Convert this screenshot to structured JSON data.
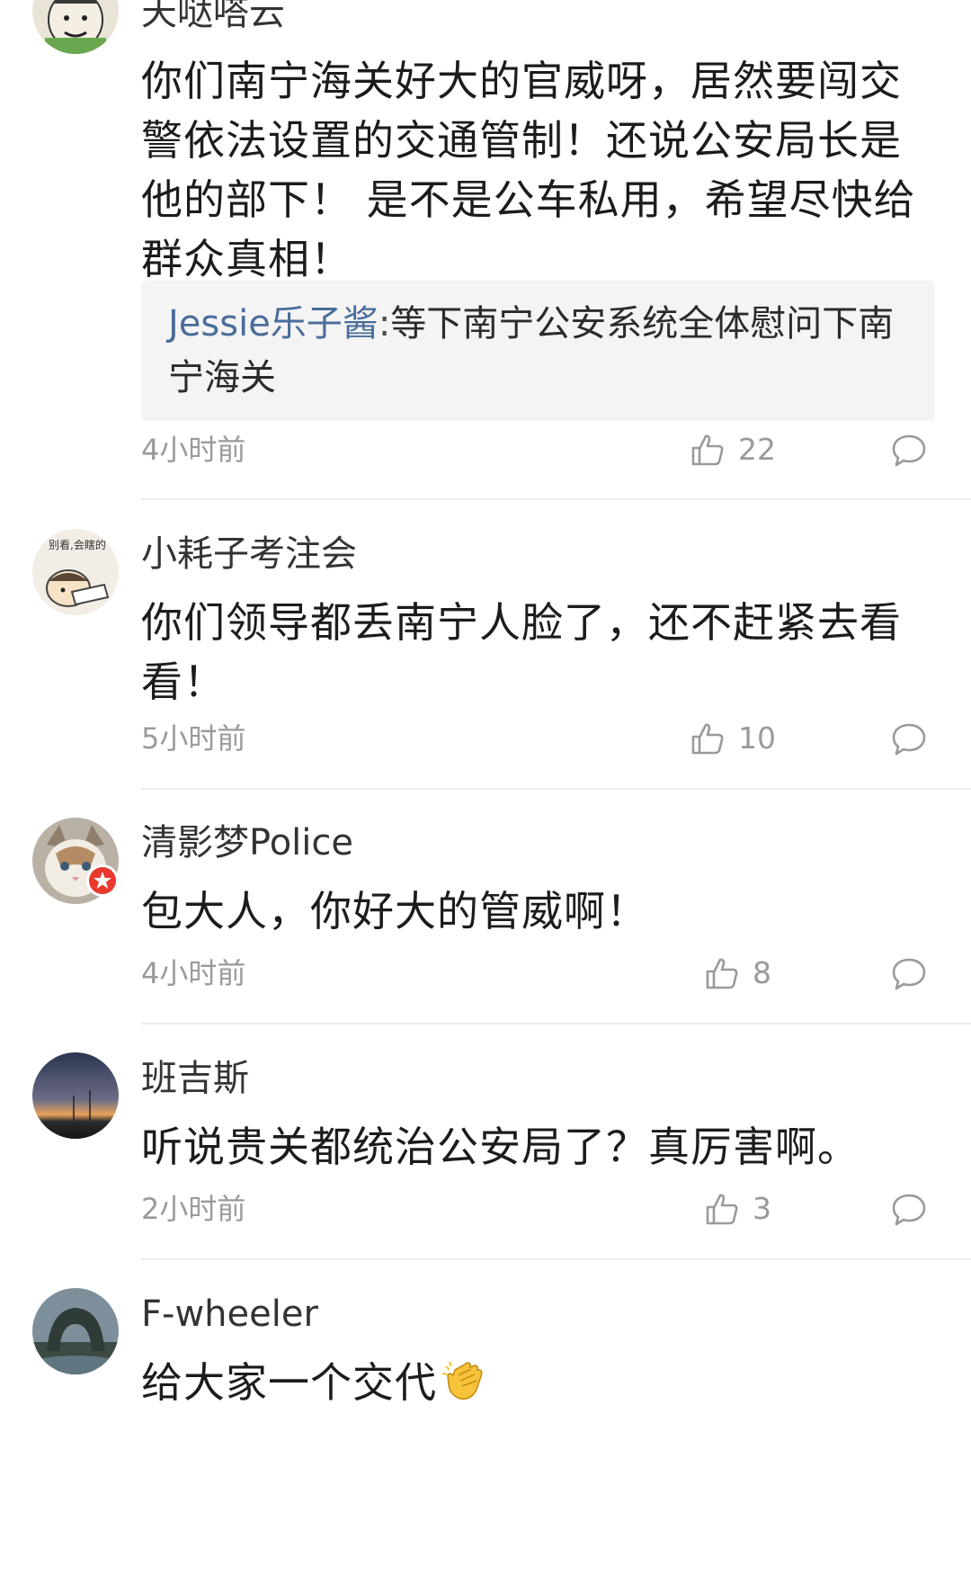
{
  "comments": [
    {
      "username": "天哒嗒云",
      "content": "你们南宁海关好大的官威呀，居然要闯交警依法设置的交通管制！还说公安局长是他的部下！ 是不是公车私用，希望尽快给群众真相！",
      "reply": {
        "author": "Jessie乐子酱",
        "separator": ":",
        "text": "等下南宁公安系统全体慰问下南宁海关"
      },
      "time": "4小时前",
      "likes": "22"
    },
    {
      "username": "小耗子考注会",
      "avatar_text": "别看,会瞎的",
      "content": "你们领导都丢南宁人脸了，还不赶紧去看看！",
      "time": "5小时前",
      "likes": "10"
    },
    {
      "username": "清影梦Police",
      "content": "包大人，你好大的管威啊！",
      "time": "4小时前",
      "likes": "8"
    },
    {
      "username": "班吉斯",
      "content": "听说贵关都统治公安局了？真厉害啊。",
      "time": "2小时前",
      "likes": "3"
    },
    {
      "username": "F-wheeler",
      "content": "给大家一个交代",
      "emoji": "clapping-hands-emoji"
    }
  ],
  "icons": {
    "like": "thumbs-up-icon",
    "reply": "comment-bubble-icon",
    "badge": "star-badge-icon"
  },
  "colors": {
    "reply_author": "#4a6d9a",
    "meta_gray": "#9a9a9a",
    "reply_background": "#f4f4f4",
    "badge_red": "#e8392c"
  }
}
